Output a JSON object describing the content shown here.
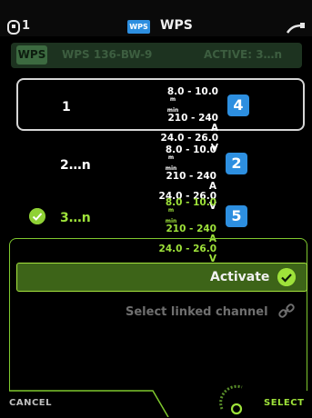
{
  "topbar": {
    "slot_number": "1",
    "wps_badge": "WPS",
    "title": "WPS"
  },
  "header": {
    "badge": "WPS",
    "name": "WPS 136-BW-9",
    "active": "ACTIVE: 3…n"
  },
  "rows": [
    {
      "channel": "1",
      "speed": "8.0 - 10.0",
      "current": "210 - 240",
      "voltage": "24.0 - 26.0",
      "current_unit": "A",
      "voltage_unit": "V",
      "speed_unit_top": "m",
      "speed_unit_bottom": "min",
      "badge": "4"
    },
    {
      "channel": "2…n",
      "speed": "8.0 - 10.0",
      "current": "210 - 240",
      "voltage": "24.0 - 26.0",
      "current_unit": "A",
      "voltage_unit": "V",
      "speed_unit_top": "m",
      "speed_unit_bottom": "min",
      "badge": "2"
    },
    {
      "channel": "3…n",
      "speed": "8.0 - 10.0",
      "current": "210 - 240",
      "voltage": "24.0 - 26.0",
      "current_unit": "A",
      "voltage_unit": "V",
      "speed_unit_top": "m",
      "speed_unit_bottom": "min",
      "badge": "5"
    }
  ],
  "panel": {
    "activate_label": "Activate",
    "linked_label": "Select linked channel"
  },
  "bottom": {
    "cancel_label": "CANCEL",
    "select_label": "SELECT"
  },
  "colors": {
    "accent_green": "#9ee23a",
    "badge_blue": "#2d8fe0"
  }
}
